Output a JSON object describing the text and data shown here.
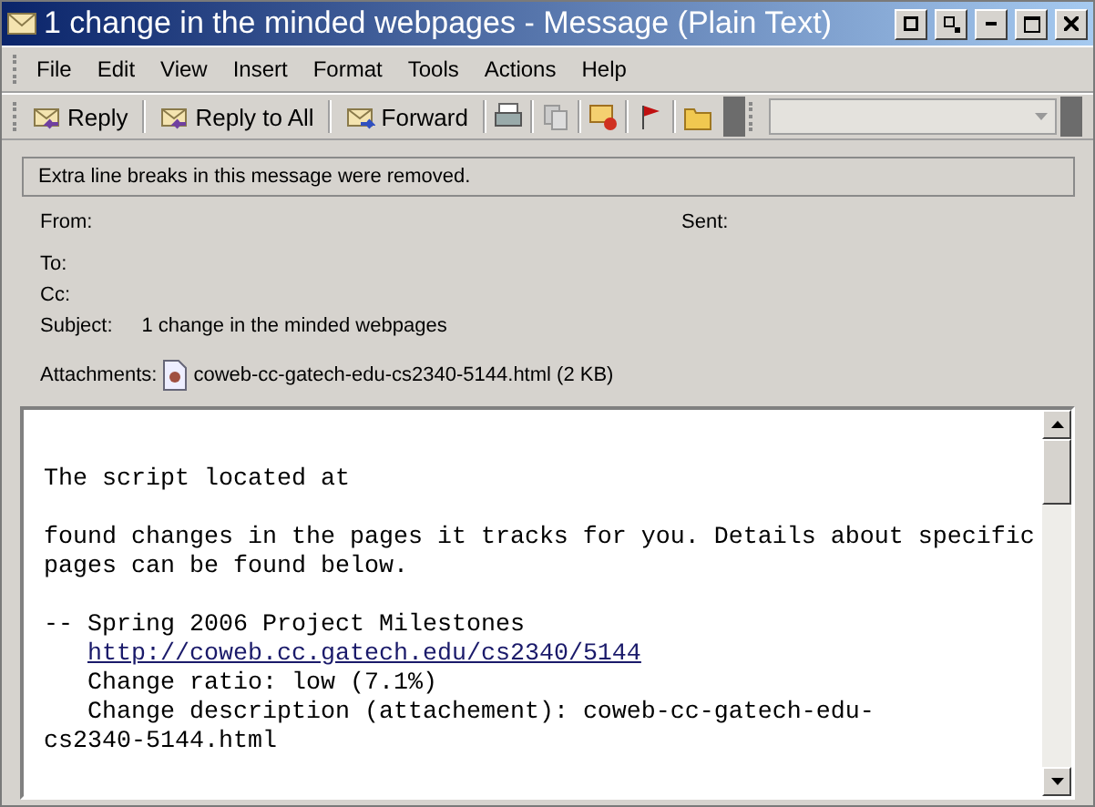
{
  "window": {
    "title": "1 change in the minded webpages - Message (Plain Text)"
  },
  "menu": [
    "File",
    "Edit",
    "View",
    "Insert",
    "Format",
    "Tools",
    "Actions",
    "Help"
  ],
  "toolbar": [
    {
      "kind": "button",
      "label": "Reply"
    },
    {
      "kind": "button",
      "label": "Reply to All"
    },
    {
      "kind": "button",
      "label": "Forward"
    },
    {
      "kind": "icon"
    },
    {
      "kind": "icon"
    },
    {
      "kind": "icon"
    },
    {
      "kind": "icon"
    },
    {
      "kind": "icon"
    }
  ],
  "info_bar": "Extra line breaks in this message were removed.",
  "headers": {
    "from": "From:",
    "sent": "Sent:",
    "to": "To:",
    "cc": "Cc:",
    "subject_label": "Subject:",
    "subject": "1 change in the minded webpages",
    "attachments_label": "Attachments:",
    "attachment": "coweb-cc-gatech-edu-cs2340-5144.html (2 KB)"
  },
  "body": [
    [
      {
        "kind": "text",
        "text": "The script located at"
      }
    ],
    [
      {
        "kind": "text",
        "text": "found changes in the pages it tracks for you. Details about specific"
      },
      {
        "kind": "text",
        "text": "pages can be found below."
      }
    ],
    [
      {
        "kind": "text",
        "text": "-- Spring 2006 Project Milestones"
      },
      {
        "kind": "link",
        "text": "http://coweb.cc.gatech.edu/cs2340/5144"
      },
      {
        "kind": "indented",
        "text": "Change ratio: low (7.1%)"
      },
      {
        "kind": "indented",
        "text": "Change description (attachement): coweb-cc-gatech-edu-"
      },
      {
        "kind": "text",
        "text": "cs2340-5144.html"
      }
    ]
  ]
}
